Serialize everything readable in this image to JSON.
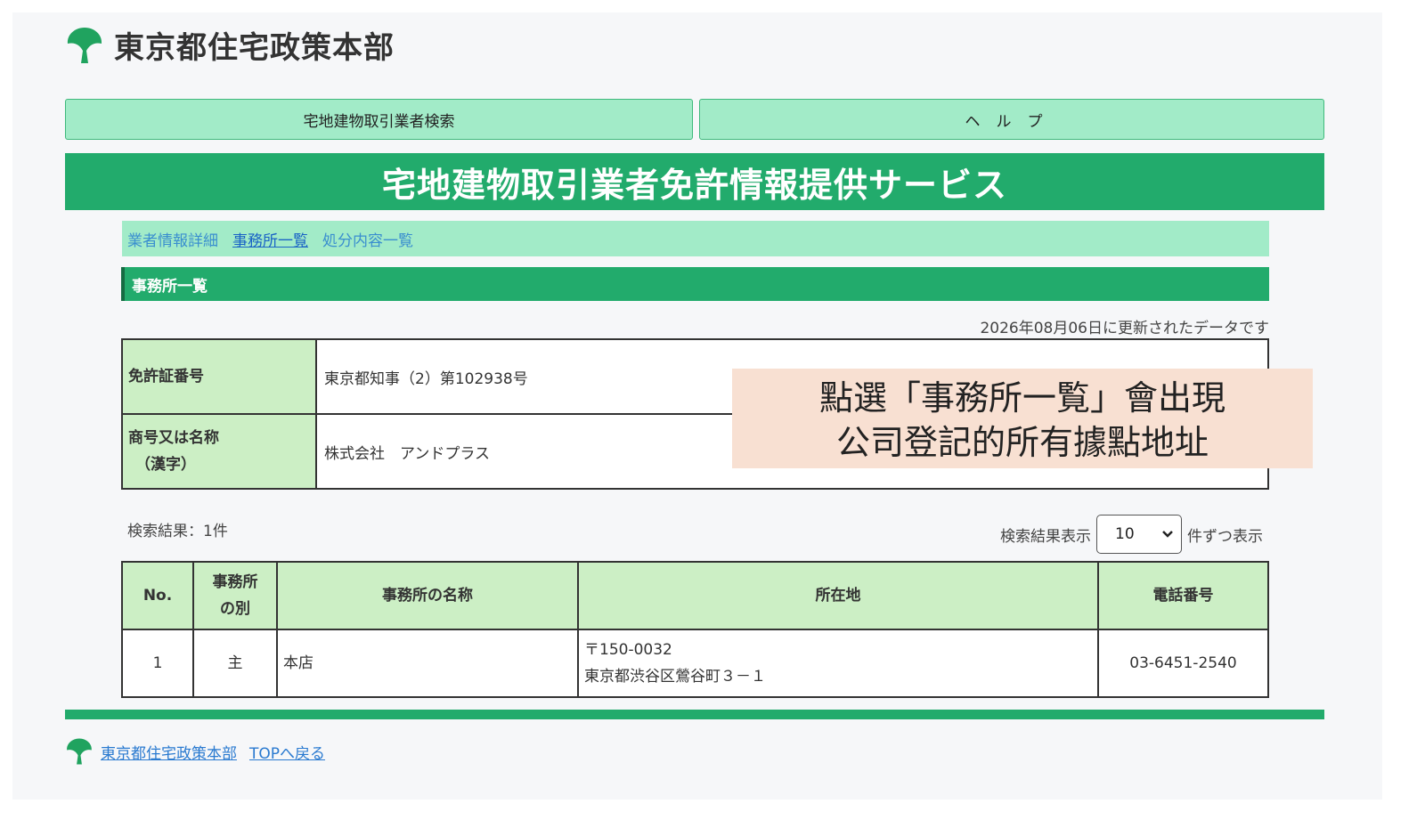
{
  "header": {
    "org_name": "東京都住宅政策本部",
    "logo_icon": "ginkgo-leaf-icon"
  },
  "nav": {
    "search_label": "宅地建物取引業者検索",
    "help_label": "ヘルプ"
  },
  "banner": {
    "title": "宅地建物取引業者免許情報提供サービス"
  },
  "tabs": [
    {
      "label": "業者情報詳細"
    },
    {
      "label": "事務所一覧"
    },
    {
      "label": "処分内容一覧"
    }
  ],
  "section": {
    "title": "事務所一覧"
  },
  "updated_text": "2026年08月06日に更新されたデータです",
  "info": [
    {
      "label": "免許証番号",
      "value": "東京都知事（2）第102938号"
    },
    {
      "label_line1": "商号又は名称",
      "label_line2": "（漢字）",
      "value": "株式会社　アンドプラス"
    }
  ],
  "results": {
    "count_text": "検索結果：1件",
    "per_page_label": "検索結果表示",
    "per_page_value": "10",
    "per_page_suffix": "件ずつ表示"
  },
  "list": {
    "headers": {
      "no": "No.",
      "type_line1": "事務所",
      "type_line2": "の別",
      "name": "事務所の名称",
      "address": "所在地",
      "phone": "電話番号"
    },
    "rows": [
      {
        "no": "1",
        "type": "主",
        "name": "本店",
        "postal": "〒150-0032",
        "address": "東京都渋谷区鶯谷町３－１",
        "phone": "03-6451-2540"
      }
    ]
  },
  "footer": {
    "org_link": "東京都住宅政策本部",
    "top_link": "TOPへ戻る"
  },
  "callout": {
    "line1": "點選「事務所一覧」會出現",
    "line2": "公司登記的所有據點地址"
  },
  "colors": {
    "green": "#22ab6c",
    "light_green": "#a2ebc8",
    "label_green": "#ccefc5",
    "callout_bg": "#f8e0d2"
  }
}
